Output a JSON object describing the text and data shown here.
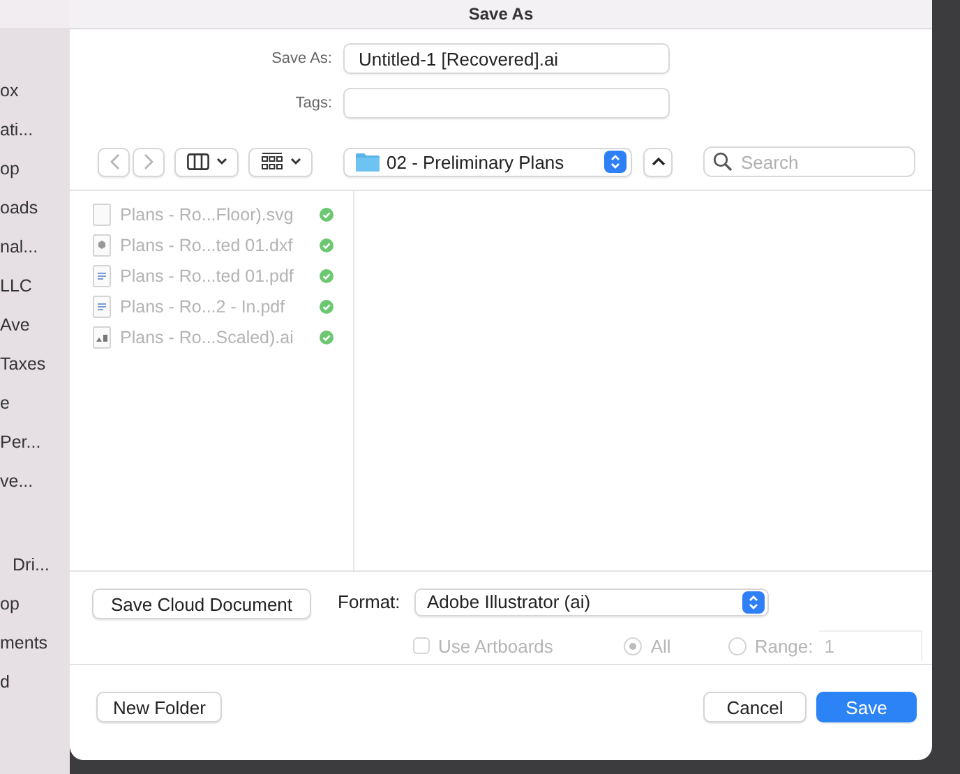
{
  "window": {
    "title": "Save As"
  },
  "sidebar": {
    "items": [
      {
        "label": "ox"
      },
      {
        "label": "ati..."
      },
      {
        "label": "op"
      },
      {
        "label": "oads"
      },
      {
        "label": "nal..."
      },
      {
        "label": "LLC"
      },
      {
        "label": "Ave"
      },
      {
        "label": "Taxes"
      },
      {
        "label": "e"
      },
      {
        "label": "Per..."
      },
      {
        "label": "ve..."
      },
      {
        "label": "Dri...",
        "gap_before": true
      },
      {
        "label": "op"
      },
      {
        "label": "ments"
      },
      {
        "label": "d"
      }
    ]
  },
  "save_as": {
    "label": "Save As:",
    "value": "Untitled-1 [Recovered].ai"
  },
  "tags": {
    "label": "Tags:"
  },
  "toolbar": {
    "location": "02 - Preliminary Plans",
    "search": {
      "placeholder": "Search"
    }
  },
  "files": [
    {
      "name": "Plans - Ro...Floor).svg",
      "kind": "blank",
      "disabled": true,
      "synced": true
    },
    {
      "name": "Plans - Ro...ted 01.dxf",
      "kind": "cube",
      "disabled": true,
      "synced": true
    },
    {
      "name": "Plans - Ro...ted 01.pdf",
      "kind": "doc",
      "disabled": true,
      "synced": true
    },
    {
      "name": "Plans - Ro...2 - In.pdf",
      "kind": "doc",
      "disabled": true,
      "synced": true
    },
    {
      "name": "Plans - Ro...Scaled).ai",
      "kind": "image",
      "disabled": true,
      "synced": true
    }
  ],
  "options": {
    "cloud_button": "Save Cloud Document",
    "format_label": "Format:",
    "format": "Adobe Illustrator (ai)",
    "disabled": true,
    "use_artboards": {
      "label": "Use Artboards",
      "checked": false
    },
    "range_options": [
      {
        "label": "All",
        "selected": true
      },
      {
        "label": "Range:",
        "selected": false
      }
    ],
    "range_value": "1"
  },
  "footer": {
    "new_folder": "New Folder",
    "cancel": "Cancel",
    "save": "Save"
  }
}
